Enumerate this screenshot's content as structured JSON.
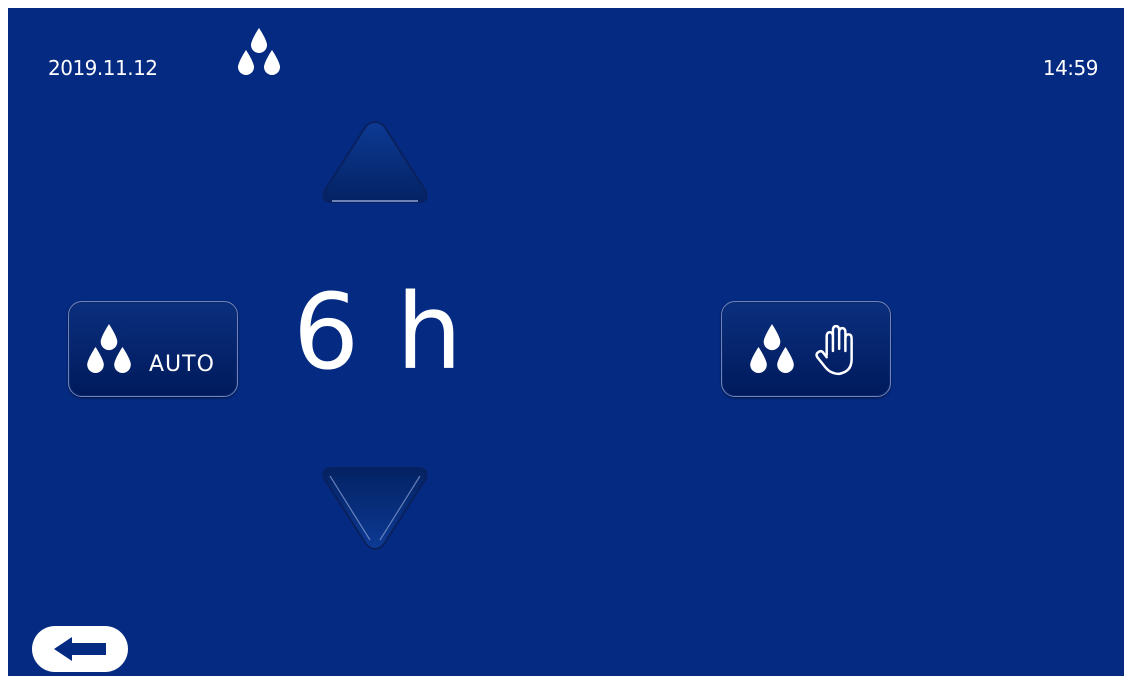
{
  "header": {
    "date": "2019.11.12",
    "time": "14:59",
    "mode_icon": "three-drops-icon"
  },
  "setting": {
    "value": "6",
    "unit": "h",
    "increase_icon": "triangle-up-icon",
    "decrease_icon": "triangle-down-icon"
  },
  "buttons": {
    "auto_label": "AUTO",
    "auto_icon": "three-drops-icon",
    "manual_icon": "three-drops-hand-icon",
    "back_icon": "arrow-left-icon"
  },
  "colors": {
    "background": "#052a82",
    "text": "#ffffff",
    "button_face": "#001a5c"
  }
}
